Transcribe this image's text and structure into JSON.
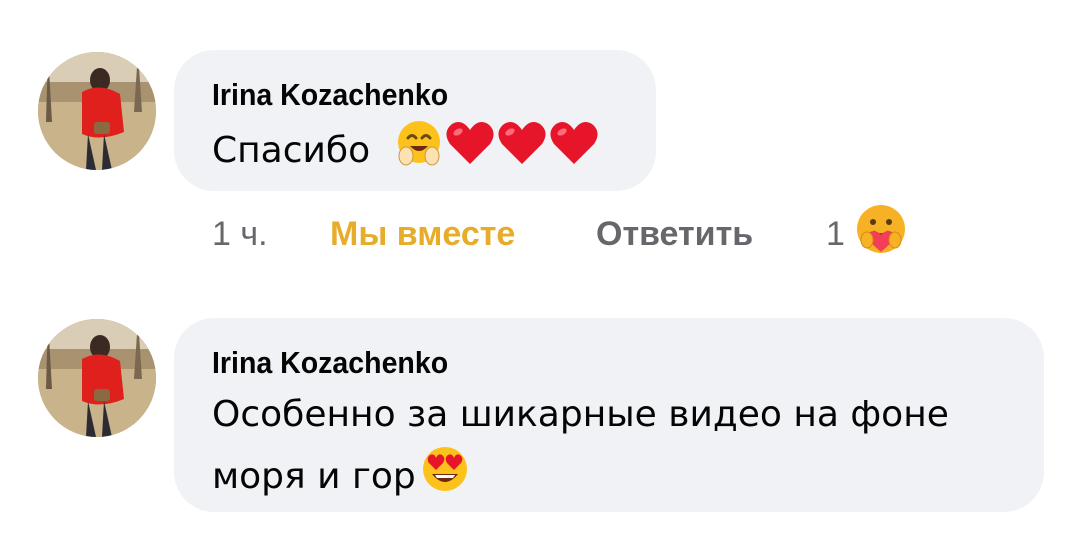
{
  "comments": [
    {
      "author": "Irina Kozachenko",
      "text": "Спасибо",
      "emojis": [
        "hugging-face",
        "red-heart",
        "red-heart",
        "red-heart"
      ],
      "actions": {
        "time": "1 ч.",
        "reaction_label": "Мы вместе",
        "reply_label": "Ответить",
        "reaction_count": "1",
        "reaction_icon": "care-reaction"
      }
    },
    {
      "author": "Irina Kozachenko",
      "text_line1": "Особенно за шикарные видео на фоне",
      "text_line2": "моря и гор",
      "emojis": [
        "heart-eyes-face"
      ]
    }
  ],
  "colors": {
    "bubble": "#f0f2f5",
    "reaction_accent": "#e6ac2a",
    "secondary_text": "#65676b",
    "primary_text": "#050505"
  }
}
